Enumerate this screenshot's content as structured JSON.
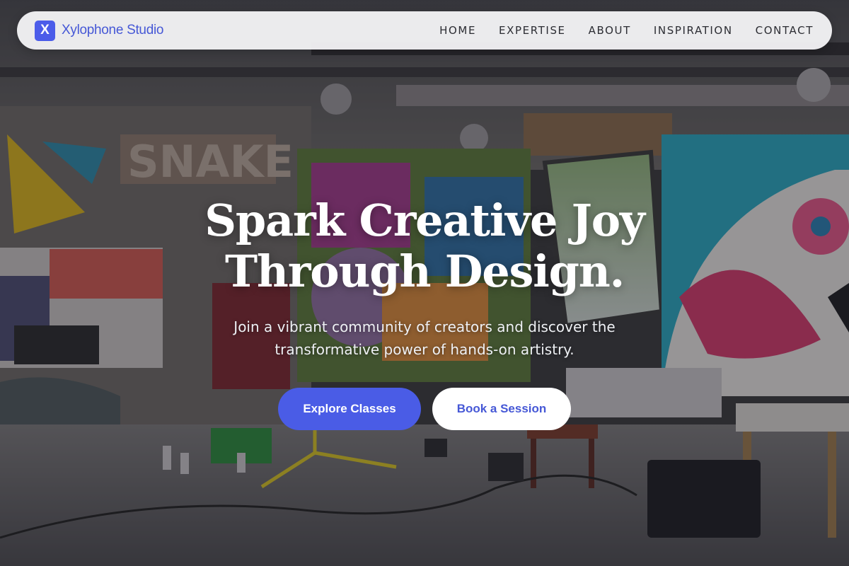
{
  "brand": {
    "mark": "X",
    "name": "Xylophone Studio"
  },
  "nav": {
    "items": [
      {
        "label": "HOME"
      },
      {
        "label": "EXPERTISE"
      },
      {
        "label": "ABOUT"
      },
      {
        "label": "INSPIRATION"
      },
      {
        "label": "CONTACT"
      }
    ]
  },
  "hero": {
    "title_line1": "Spark Creative Joy",
    "title_line2": "Through Design.",
    "subtitle": "Join a vibrant community of creators and discover the transformative power of hands-on artistry.",
    "primary_cta": "Explore Classes",
    "secondary_cta": "Book a Session"
  },
  "colors": {
    "accent": "#4a5ce6",
    "nav_background": "#f4f4f7",
    "hero_text": "#ffffff"
  }
}
